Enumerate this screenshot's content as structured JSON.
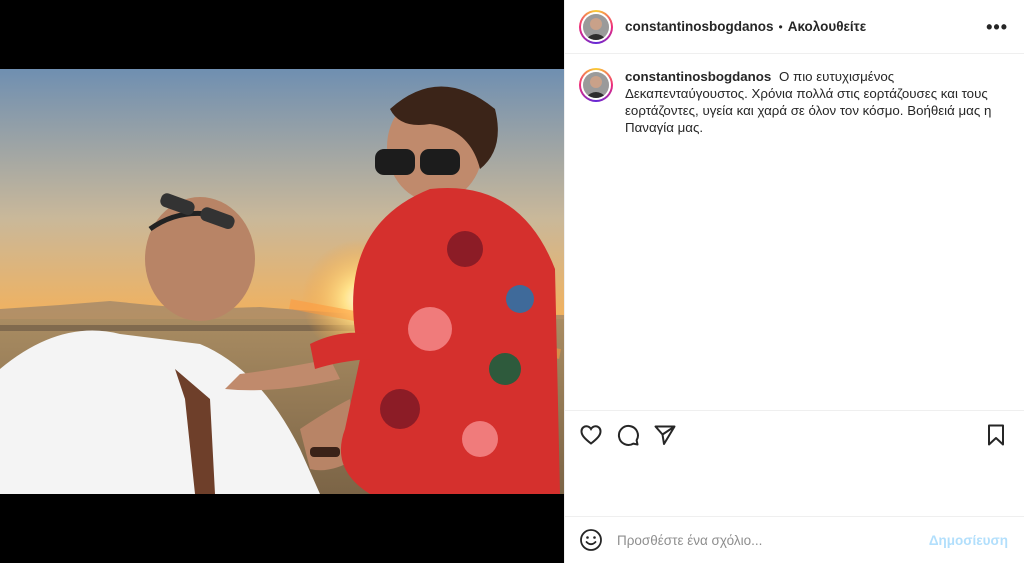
{
  "post": {
    "username": "constantinosbogdanos",
    "separator": "•",
    "follow_status": "Ακολουθείτε",
    "more_icon": "more-horizontal-icon",
    "more_glyph": "•••",
    "caption_user": "constantinosbogdanos",
    "caption_text": "Ο πιο ευτυχισμένος Δεκαπενταύγουστος. Χρόνια πολλά στις εορτάζουσες και τους εορτάζοντες, υγεία και χαρά σε όλον τον κόσμο. Βοήθειά μας η Παναγία μας."
  },
  "actions": {
    "like_icon": "heart-icon",
    "comment_icon": "comment-bubble-icon",
    "share_icon": "paper-plane-icon",
    "save_icon": "bookmark-icon"
  },
  "comment_box": {
    "placeholder": "Προσθέστε ένα σχόλιο...",
    "post_label": "Δημοσίευση",
    "emoji_icon": "smiley-icon"
  },
  "colors": {
    "post_button_disabled": "#b2dffc",
    "border": "#efefef",
    "text": "#262626",
    "secondary_text": "#8e8e8e"
  }
}
